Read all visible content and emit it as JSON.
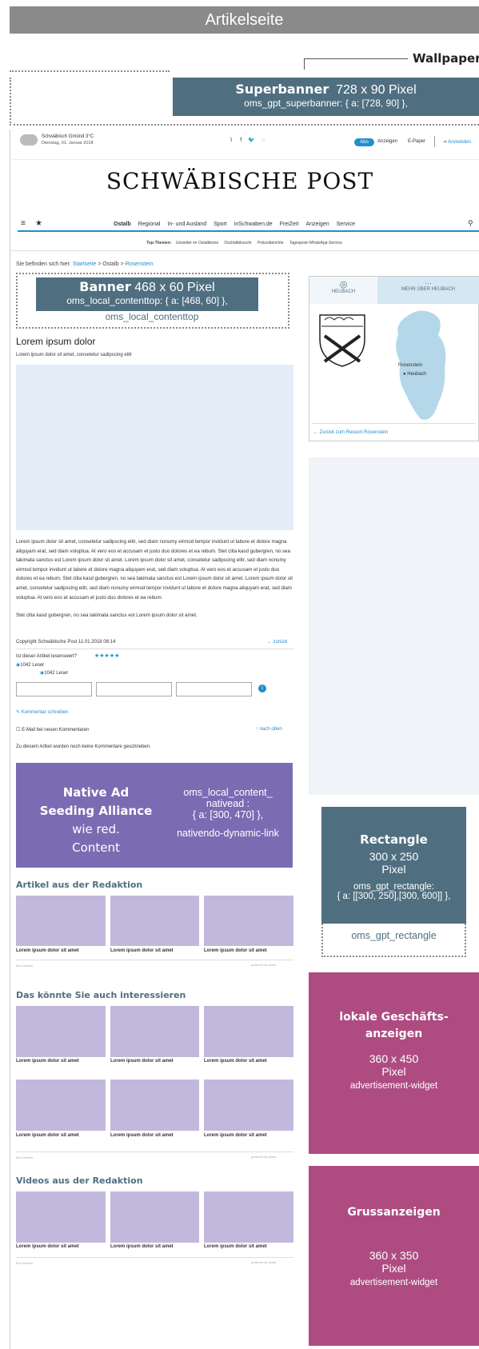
{
  "page": {
    "title": "Artikelseite",
    "wallpaper_label": "Wallpaper"
  },
  "superbanner": {
    "title_bold": "Superbanner",
    "size": "728 x 90 Pixel",
    "code": "oms_gpt_superbanner: { a: [728, 90] },"
  },
  "topbar": {
    "weather": "Schwäbisch Gmünd 3°C",
    "date": "Dienstag, 01. Januar 2018",
    "social": [
      "rss",
      "f",
      "twitter",
      "whatsapp"
    ],
    "abo": "Abo",
    "links": [
      "Anzeigen",
      "E-Paper"
    ],
    "login": "Anmelden"
  },
  "logo": "SCHWÄBISCHE POST",
  "nav": {
    "items": [
      "Ostalb",
      "Regional",
      "In- und Ausland",
      "Sport",
      "inSchwaben.de",
      "FreiZeit",
      "Anzeigen",
      "Service"
    ],
    "topthemen_label": "Top-Themen:",
    "topthemen": [
      "Unwetter im Ostalbkreis",
      "Oschtalbkoscht",
      "Polizeiberichte",
      "Tagespost-WhatsApp-Service"
    ]
  },
  "breadcrumb": {
    "prefix": "Sie befinden sich hier:",
    "home": "Startseite",
    "sep1": " > Ostalb > ",
    "current": "Rosenstein"
  },
  "banner": {
    "title_bold": "Banner",
    "size": "468 x 60 Pixel",
    "code": "oms_local_contenttop: { a: [468, 60] },",
    "name": "oms_local_contenttop"
  },
  "article": {
    "title": "Lorem ipsum dolor",
    "subtitle": "Lorem ipsum dolor sit amet, consetetur sadipscing elitr",
    "body1": "Lorem ipsum dolor sit amet, consetetur sadipscing elitr, sed diam nonumy eirmod tempor invidunt ut labore et dolore magna aliquyam erat, sed diam voluptua. At vero eos et accusam et justo duo dolores et ea rebum. Stet clita kasd gubergren, no sea takimata sanctus est Lorem ipsum dolor sit amet. Lorem ipsum dolor sit amet, consetetur sadipscing elitr, sed diam nonumy eirmod tempor invidunt ut labore et dolore magna aliquyam erat, sed diam voluptua. At vero eos et accusam et justo duo dolores et ea rebum. Stet clita kasd gubergren, no sea takimata sanctus est Lorem ipsum dolor sit amet. Lorem ipsum dolor sit amet, consetetur sadipscing elitr, sed diam nonumy eirmod tempor invidunt ut labore et dolore magna aliquyam erat, sed diam voluptua. At vero eos et accusam et justo duo dolores et ea rebum.",
    "body2": "Stet clita kasd gubergren, no sea takimata sanctus est Lorem ipsum dolor sit amet.",
    "copyright": "Copyright Schwäbische Post 11.01.2018 08:14",
    "back": "zurück",
    "rating_q": "Ist dieser Artikel lesenswert?",
    "stars": "★★★★★",
    "readers1": "1042 Leser",
    "readers2": "1042 Leser",
    "comment_write": "Kommentar schreiben",
    "email_notify": "E-Mail bei neuen Kommentaren",
    "to_top": "nach oben",
    "no_comments": "Zu diesem Artkel wurden noch keine Kommentare geschrieben."
  },
  "native": {
    "line1": "Native Ad",
    "line2": "Seeding Alliance",
    "line3": "wie red.",
    "line4": "Content",
    "code1": "oms_local_content_",
    "code2": "nativead :",
    "code3": "{ a: [300, 470] },",
    "code4": "nativendo-dynamic-link"
  },
  "sections": [
    {
      "title": "Artikel aus der Redaktion",
      "cards": [
        "Lorem ipsum dolor sit amet",
        "Lorem ipsum dolor sit amet",
        "Lorem ipsum dolor sit amet"
      ],
      "ad_label": "Ihre werben",
      "powered": "powered by plista"
    },
    {
      "title": "Das könnte Sie auch interessieren",
      "cards": [
        "Lorem ipsum dolor sit amet",
        "Lorem ipsum dolor sit amet",
        "Lorem ipsum dolor sit amet",
        "Lorem ipsum dolor sit amet",
        "Lorem ipsum dolor sit amet",
        "Lorem ipsum dolor sit amet"
      ],
      "ad_label": "Ihre werben",
      "powered": "powered by plista"
    },
    {
      "title": "Videos aus der Redaktion",
      "cards": [
        "Lorem ipsum dolor sit amet",
        "Lorem ipsum dolor sit amet",
        "Lorem ipsum dolor sit amet"
      ],
      "ad_label": "Ihre werben",
      "powered": "powered by plista"
    }
  ],
  "map": {
    "tab1": "HEUBACH",
    "tab2": "MEHR ÜBER HEUBACH",
    "place1": "Rosenstein",
    "place2": "Heubach",
    "back_link": "Zurück zum Ressort Rosenstein"
  },
  "rectangle": {
    "title": "Rectangle",
    "size1": "300 x 250",
    "size2": "Pixel",
    "code1": "oms_gpt_rectangle:",
    "code2": "{ a: [[300, 250],[300, 600]] },",
    "name": "oms_gpt_rectangle"
  },
  "lokal": {
    "title1": "lokale Geschäfts-",
    "title2": "anzeigen",
    "size1": "360 x 450",
    "size2": "Pixel",
    "code": "advertisement-widget"
  },
  "gruss": {
    "title": "Grussanzeigen",
    "size1": "360 x 350",
    "size2": "Pixel",
    "code": "advertisement-widget"
  },
  "colors": {
    "accent": "#1e8ed0",
    "ad_slate": "#4f6f80",
    "native": "#7b6bb3",
    "magenta": "#ae4c82",
    "card": "#c2b8dc"
  }
}
